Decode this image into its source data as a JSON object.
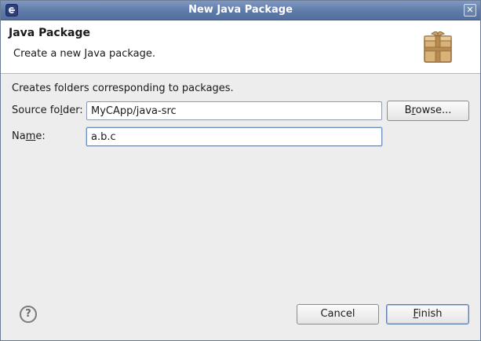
{
  "window": {
    "title": "New Java Package",
    "close_glyph": "✕"
  },
  "header": {
    "title": "Java Package",
    "description": "Create a new Java package.",
    "icon": "package-icon"
  },
  "form": {
    "intro": "Creates folders corresponding to packages.",
    "source_folder": {
      "label_before": "Source fo",
      "mnemonic": "l",
      "label_after": "der:",
      "value": "MyCApp/java-src"
    },
    "name": {
      "label_before": "Na",
      "mnemonic": "m",
      "label_after": "e:",
      "value": "a.b.c"
    },
    "browse": {
      "label_before": "B",
      "mnemonic": "r",
      "label_after": "owse..."
    }
  },
  "footer": {
    "help_glyph": "?",
    "cancel_label": "Cancel",
    "finish": {
      "mnemonic": "F",
      "label_after": "inish"
    }
  },
  "colors": {
    "titlebar": "#5e7aa8",
    "header_bg": "#ffffff",
    "dialog_bg": "#ededed",
    "default_button_border": "#5f7fb3"
  }
}
